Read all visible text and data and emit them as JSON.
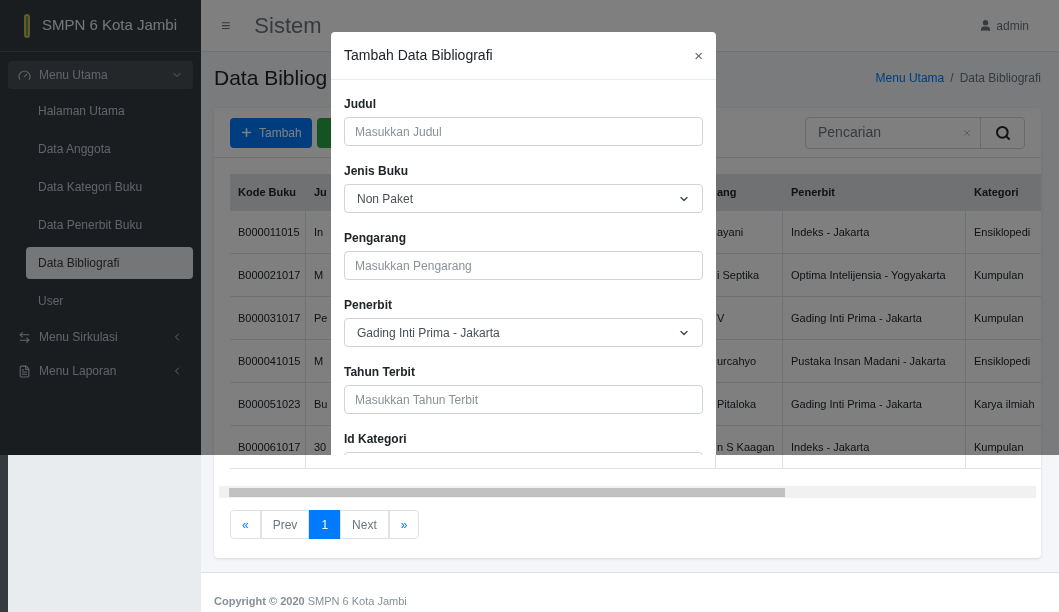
{
  "sidebar": {
    "brand": "SMPN 6 Kota Jambi",
    "menus": [
      {
        "label": "Menu Utama",
        "expanded": true,
        "children": [
          {
            "label": "Halaman Utama",
            "selected": false
          },
          {
            "label": "Data Anggota",
            "selected": false
          },
          {
            "label": "Data Kategori Buku",
            "selected": false
          },
          {
            "label": "Data Penerbit Buku",
            "selected": false
          },
          {
            "label": "Data Bibliografi",
            "selected": true
          },
          {
            "label": "User",
            "selected": false
          }
        ]
      },
      {
        "label": "Menu Sirkulasi",
        "expanded": false
      },
      {
        "label": "Menu Laporan",
        "expanded": false
      }
    ]
  },
  "navbar": {
    "menu_toggle": "≡",
    "title": "Sistem",
    "user": "admin"
  },
  "page": {
    "heading": "Data Bibliog",
    "breadcrumb": [
      "Menu Utama",
      "Data Bibliografi"
    ],
    "breadcrumb_separator": "/"
  },
  "toolbar": {
    "add_button": "Tambah",
    "search": {
      "placeholder": "Pencarian"
    }
  },
  "table": {
    "columns": [
      "Kode Buku",
      "Ju",
      "ang",
      "Penerbit",
      "Kategori"
    ],
    "rows": [
      [
        "B000011015",
        "In",
        "ayani",
        "Indeks - Jakarta",
        "Ensiklopedi"
      ],
      [
        "B000021017",
        "M",
        "i Septika",
        "Optima Intelijensia - Yogyakarta",
        "Kumpulan"
      ],
      [
        "B000031017",
        "Pe",
        "V",
        "Gading Inti Prima - Jakarta",
        "Kumpulan"
      ],
      [
        "B000041015",
        "M",
        "urcahyo",
        "Pustaka Insan Madani - Jakarta",
        "Ensiklopedi"
      ],
      [
        "B000051023",
        "Bu",
        "Pitaloka",
        "Gading Inti Prima - Jakarta",
        "Karya ilmiah"
      ],
      [
        "B000061017",
        "30",
        "n S Kaagan",
        "Indeks - Jakarta",
        "Kumpulan"
      ]
    ]
  },
  "pagination": [
    {
      "label": "«",
      "selected": false
    },
    {
      "label": "Prev",
      "selected": false
    },
    {
      "label": "1",
      "selected": true
    },
    {
      "label": "Next",
      "selected": false
    },
    {
      "label": "»",
      "selected": false
    }
  ],
  "footer": "**Copyright © 2020** SMPN 6 Kota Jambi",
  "modal": {
    "title": "Tambah Data Bibliografi",
    "close": "×",
    "fields": [
      {
        "label": "Judul",
        "kind": "input",
        "placeholder": "Masukkan Judul"
      },
      {
        "label": "Jenis Buku",
        "kind": "select",
        "value": "Non Paket"
      },
      {
        "label": "Pengarang",
        "kind": "input",
        "placeholder": "Masukkan Pengarang"
      },
      {
        "label": "Penerbit",
        "kind": "select",
        "value": "Gading Inti Prima - Jakarta"
      },
      {
        "label": "Tahun Terbit",
        "kind": "input",
        "placeholder": "Masukkan Tahun Terbit"
      },
      {
        "label": "Id Kategori",
        "kind": "input"
      }
    ]
  }
}
